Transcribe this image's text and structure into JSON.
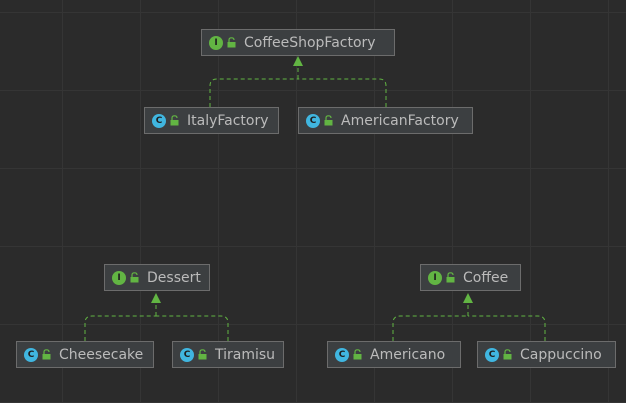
{
  "nodes": {
    "coffee_shop_factory": {
      "label": "CoffeeShopFactory",
      "kind": "interface",
      "badge": "I"
    },
    "italy_factory": {
      "label": "ItalyFactory",
      "kind": "class",
      "badge": "C"
    },
    "american_factory": {
      "label": "AmericanFactory",
      "kind": "class",
      "badge": "C"
    },
    "dessert": {
      "label": "Dessert",
      "kind": "interface",
      "badge": "I"
    },
    "cheesecake": {
      "label": "Cheesecake",
      "kind": "class",
      "badge": "C"
    },
    "tiramisu": {
      "label": "Tiramisu",
      "kind": "class",
      "badge": "C"
    },
    "coffee": {
      "label": "Coffee",
      "kind": "interface",
      "badge": "I"
    },
    "americano": {
      "label": "Americano",
      "kind": "class",
      "badge": "C"
    },
    "cappuccino": {
      "label": "Cappuccino",
      "kind": "class",
      "badge": "C"
    }
  },
  "edges": [
    {
      "from": "italy_factory",
      "to": "coffee_shop_factory",
      "type": "implements"
    },
    {
      "from": "american_factory",
      "to": "coffee_shop_factory",
      "type": "implements"
    },
    {
      "from": "cheesecake",
      "to": "dessert",
      "type": "implements"
    },
    {
      "from": "tiramisu",
      "to": "dessert",
      "type": "implements"
    },
    {
      "from": "americano",
      "to": "coffee",
      "type": "implements"
    },
    {
      "from": "cappuccino",
      "to": "coffee",
      "type": "implements"
    }
  ],
  "colors": {
    "background": "#2b2b2b",
    "grid": "#353535",
    "node_fill": "#3c3f41",
    "node_border": "#6c6c6c",
    "text": "#bbbbbb",
    "interface_badge": "#62b543",
    "class_badge": "#40b6e0",
    "edge": "#62b543"
  }
}
